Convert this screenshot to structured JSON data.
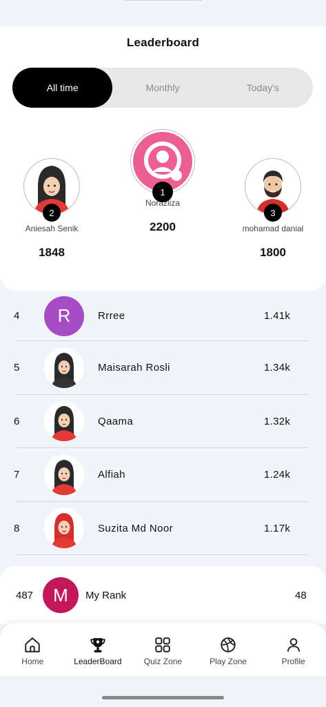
{
  "header": {
    "title": "Leaderboard"
  },
  "tabs": [
    {
      "label": "All time",
      "active": true
    },
    {
      "label": "Monthly",
      "active": false
    },
    {
      "label": "Today's",
      "active": false
    }
  ],
  "podium": {
    "first": {
      "rank": "1",
      "name": "Norazliza",
      "score": "2200",
      "avatar": "default-user-icon"
    },
    "second": {
      "rank": "2",
      "name": "Aniesah Senik",
      "score": "1848",
      "avatar": "hijab-girl-icon"
    },
    "third": {
      "rank": "3",
      "name": "mohamad danial",
      "score": "1800",
      "avatar": "bearded-man-icon"
    }
  },
  "list": [
    {
      "rank": "4",
      "name": "Rrree",
      "score": "1.41k",
      "avatar": "letter-avatar",
      "letter": "R",
      "avatar_color": "#a54bc4"
    },
    {
      "rank": "5",
      "name": "Maisarah Rosli",
      "score": "1.34k",
      "avatar": "hijab-girl-dark-icon"
    },
    {
      "rank": "6",
      "name": "Qaama",
      "score": "1.32k",
      "avatar": "hijab-girl-icon"
    },
    {
      "rank": "7",
      "name": "Alfiah",
      "score": "1.24k",
      "avatar": "hijab-girl-icon"
    },
    {
      "rank": "8",
      "name": "Suzita Md Noor",
      "score": "1.17k",
      "avatar": "hijab-girl-red-icon"
    }
  ],
  "my_rank": {
    "rank": "487",
    "letter": "M",
    "label": "My Rank",
    "score": "48",
    "avatar_color": "#c2185b"
  },
  "nav": [
    {
      "label": "Home",
      "icon": "home-icon"
    },
    {
      "label": "LeaderBoard",
      "icon": "trophy-icon",
      "active": true
    },
    {
      "label": "Quiz Zone",
      "icon": "grid-icon"
    },
    {
      "label": "Play Zone",
      "icon": "basketball-icon"
    },
    {
      "label": "Profile",
      "icon": "person-icon"
    }
  ],
  "colors": {
    "accent": "#000000",
    "default_avatar": "#ec5f93",
    "letter_r": "#a54bc4",
    "letter_m": "#c2185b"
  }
}
